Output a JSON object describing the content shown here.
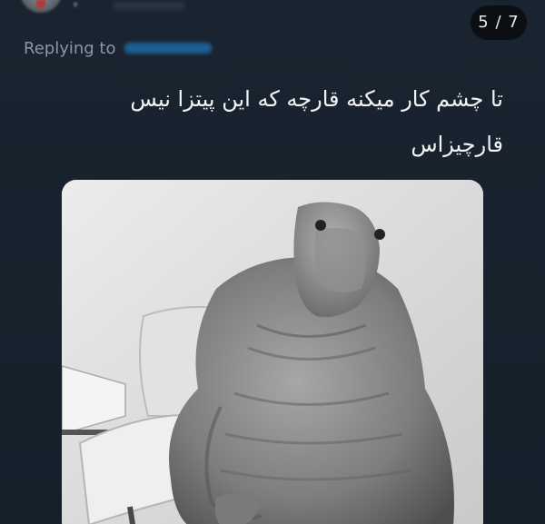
{
  "header": {
    "counter": "5 / 7"
  },
  "reply": {
    "label": "Replying to"
  },
  "tweet": {
    "line1": "تا چشم کار میکنه قارچه که این پیتزا نیس",
    "line2": "قارچیزاس"
  },
  "media": {
    "description_icon": "image-icon"
  },
  "colors": {
    "background": "#15202b",
    "text": "#f2f4f5",
    "muted": "#8b98a5",
    "link": "#1d9bf0",
    "badge": "#0b0f14"
  }
}
